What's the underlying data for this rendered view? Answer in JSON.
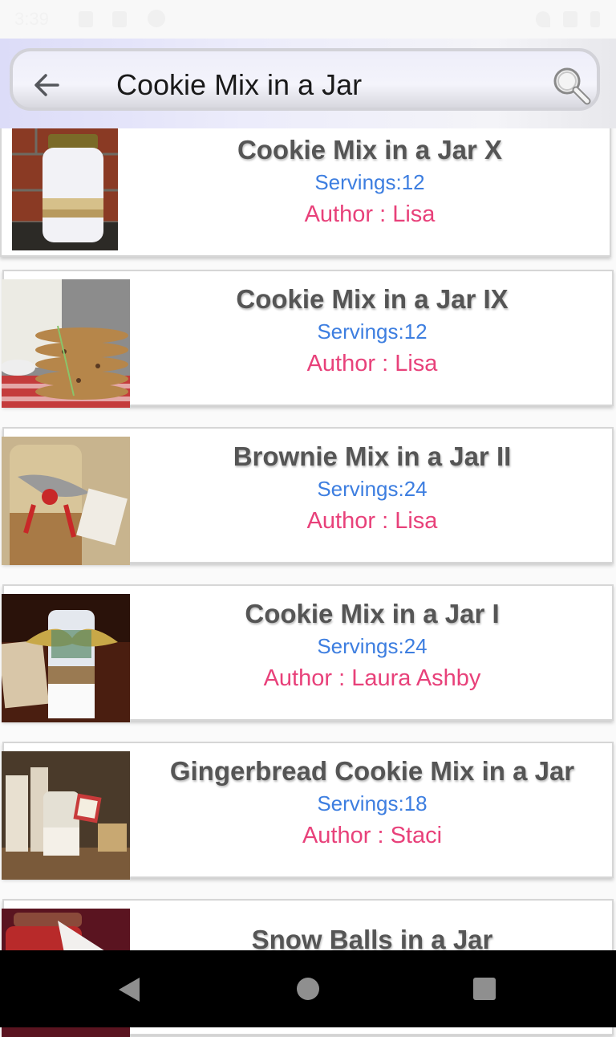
{
  "status_bar": {
    "time": "3:39"
  },
  "header": {
    "title": "Cookie Mix in a Jar",
    "back_icon": "arrow-left-icon",
    "search_icon": "magnifier-icon"
  },
  "recipes": [
    {
      "title": "Cookie Mix in a Jar X",
      "servings": "Servings:12",
      "author": "Author : Lisa",
      "image": "jar-photo-white-layers"
    },
    {
      "title": "Cookie Mix in a Jar IX",
      "servings": "Servings:12",
      "author": "Author : Lisa",
      "image": "stacked-cookies-photo"
    },
    {
      "title": "Brownie Mix in a Jar II",
      "servings": "Servings:24",
      "author": "Author : Lisa",
      "image": "jar-with-red-bow-photo"
    },
    {
      "title": "Cookie Mix in a Jar I",
      "servings": "Servings:24",
      "author": "Author : Laura Ashby",
      "image": "mason-jar-gold-bow-photo"
    },
    {
      "title": "Gingerbread Cookie Mix in a Jar",
      "servings": "Servings:18",
      "author": "Author : Staci",
      "image": "gingerbread-jars-photo"
    },
    {
      "title": "Snow Balls in a Jar",
      "servings": "",
      "author": "",
      "image": "jar-red-ribbon-photo"
    }
  ],
  "colors": {
    "title_text": "#555555",
    "servings_text": "#3d7ee0",
    "author_text": "#e8417a"
  },
  "nav_bar": {
    "back": "back-triangle-icon",
    "home": "home-circle-icon",
    "recents": "recents-square-icon"
  }
}
